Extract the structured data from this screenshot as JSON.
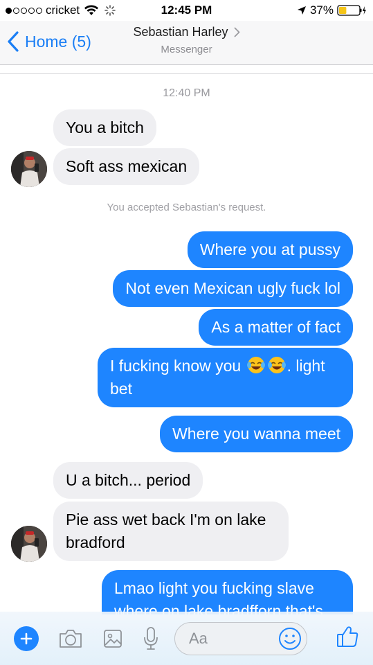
{
  "status_bar": {
    "carrier": "cricket",
    "time": "12:45 PM",
    "battery": "37%",
    "battery_level": 0.37
  },
  "header": {
    "back_label": "Home (5)",
    "contact_name": "Sebastian Harley",
    "contact_subtitle": "Messenger"
  },
  "thread": {
    "timestamp": "12:40 PM",
    "request_notice": "You accepted Sebastian's request.",
    "messages": [
      {
        "from": "them",
        "text": "You a bitch"
      },
      {
        "from": "them",
        "text": "Soft ass mexican"
      },
      {
        "from": "me",
        "text": "Where you at pussy"
      },
      {
        "from": "me",
        "text": "Not even Mexican ugly fuck lol"
      },
      {
        "from": "me",
        "text": "As a matter of fact"
      },
      {
        "from": "me",
        "text_before": "I fucking know you",
        "emoji": [
          "face-with-tears-of-joy",
          "face-with-tears-of-joy"
        ],
        "text_after": ". light",
        "text_line2": "bet"
      },
      {
        "from": "me",
        "text": "Where you wanna meet"
      },
      {
        "from": "them",
        "text": "U a bitch... period"
      },
      {
        "from": "them",
        "text": "Pie ass wet back I'm on lake",
        "text_line2": "bradford"
      },
      {
        "from": "me",
        "text": "Lmao light you fucking slave",
        "text_line2": "where on lake bradfforn that's"
      }
    ]
  },
  "composer": {
    "placeholder": "Aa",
    "icons": [
      "plus-icon",
      "camera-icon",
      "image-icon",
      "microphone-icon",
      "emoji-icon",
      "thumbs-up-icon"
    ]
  },
  "colors": {
    "accent": "#1e85ff",
    "incoming_bubble": "#efeff2",
    "outgoing_text": "#ffffff"
  }
}
